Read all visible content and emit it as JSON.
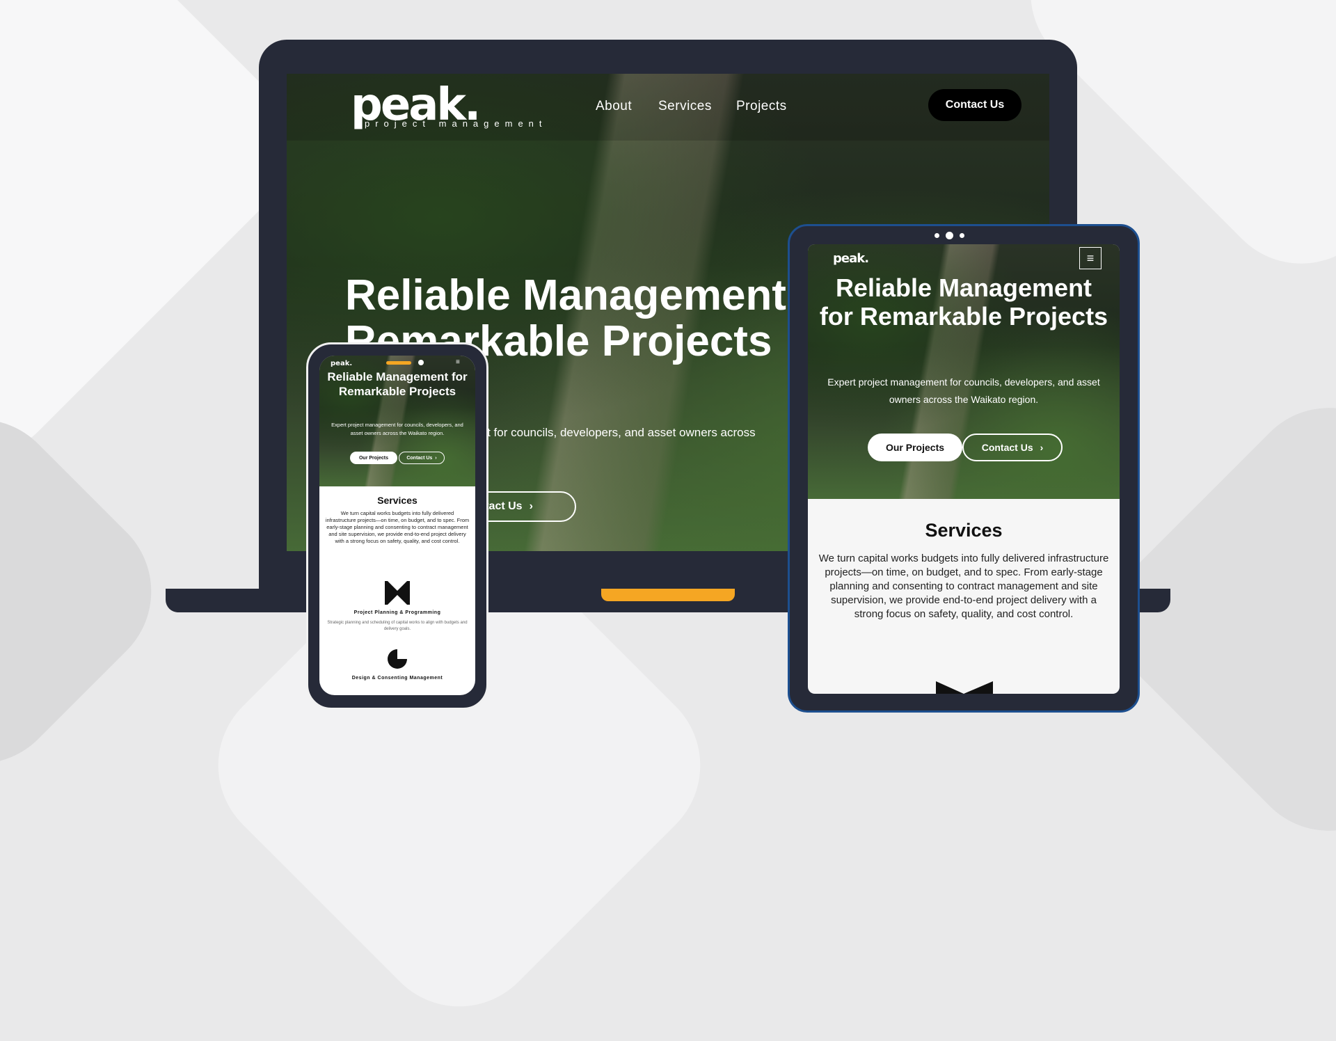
{
  "brand": {
    "logo": "peak.",
    "tagline": "project management"
  },
  "laptop": {
    "nav": {
      "about": "About",
      "services": "Services",
      "projects": "Projects"
    },
    "contact_button": "Contact Us",
    "hero": {
      "title": "Reliable Management for Remarkable Projects",
      "subtitle": "Expert project management for councils, developers, and asset owners across the Waikato region.",
      "contact_button": "Contact Us"
    }
  },
  "tablet": {
    "hero": {
      "title": "Reliable Management for Remarkable Projects",
      "subtitle": "Expert project management for councils, developers, and asset owners across the Waikato region.",
      "projects_button": "Our Projects",
      "contact_button": "Contact Us"
    },
    "services": {
      "title": "Services",
      "text": "We turn capital works budgets into fully delivered infrastructure projects—on time, on budget, and to spec. From early-stage planning and consenting to contract management and site supervision, we provide end-to-end project delivery with a strong focus on safety, quality, and cost control."
    }
  },
  "phone": {
    "hero": {
      "title": "Reliable Management for Remarkable Projects",
      "subtitle": "Expert project management for councils, developers, and asset owners across the Waikato region.",
      "projects_button": "Our Projects",
      "contact_button": "Contact Us"
    },
    "services": {
      "title": "Services",
      "text": "We turn capital works budgets into fully delivered infrastructure projects—on time, on budget, and to spec. From early-stage planning and consenting to contract management and site supervision, we provide end-to-end project delivery with a strong focus on safety, quality, and cost control.",
      "items": [
        {
          "title": "Project Planning & Programming",
          "text": "Strategic planning and scheduling of capital works to align with budgets and delivery goals."
        },
        {
          "title": "Design & Consenting Management"
        }
      ]
    }
  },
  "colors": {
    "device": "#262a38",
    "accent": "#f5a623",
    "tablet_border": "#1d4f8f"
  },
  "icons": [
    "chevron-right-icon",
    "hamburger-menu-icon",
    "bowtie-icon",
    "pie-icon"
  ]
}
